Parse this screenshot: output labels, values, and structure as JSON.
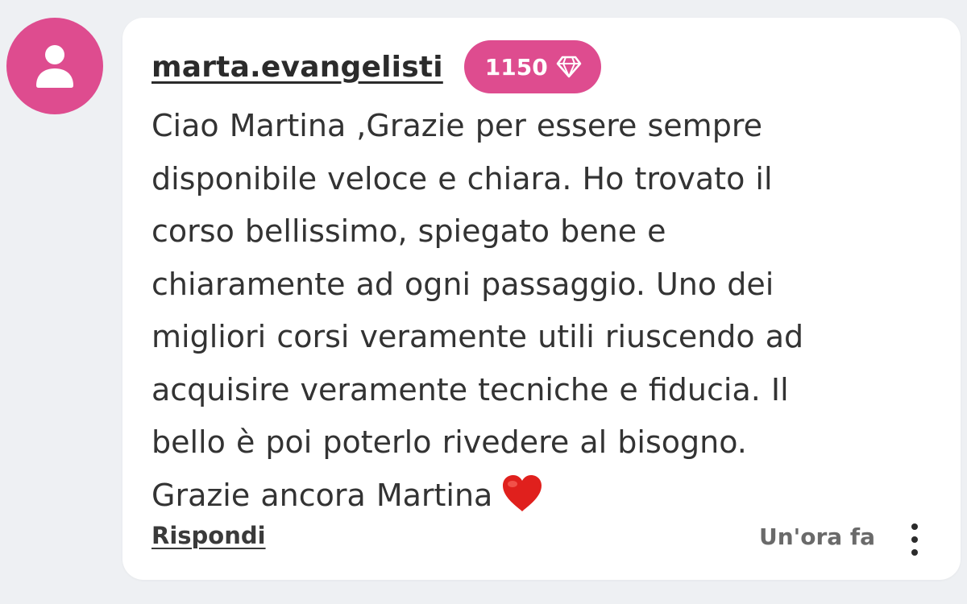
{
  "avatar": {
    "icon": "user-icon",
    "color": "#de4c8f"
  },
  "comment": {
    "username": "marta.evangelisti",
    "points_badge": {
      "value": "1150",
      "icon": "diamond-icon",
      "color": "#de4c8f"
    },
    "lines": [
      "Ciao Martina ,Grazie per essere sempre",
      "disponibile veloce e chiara. Ho trovato il",
      "corso bellissimo, spiegato bene e",
      "chiaramente ad ogni passaggio. Uno dei",
      "migliori corsi veramente utili riuscendo ad",
      "acquisire veramente tecniche e fiducia. Il",
      "bello è poi poterlo rivedere al bisogno.",
      "Grazie ancora Martina"
    ],
    "trailing_emoji": "heart-emoji",
    "reply_label": "Rispondi",
    "timestamp": "Un'ora fa",
    "menu_icon": "more-vertical-icon"
  }
}
